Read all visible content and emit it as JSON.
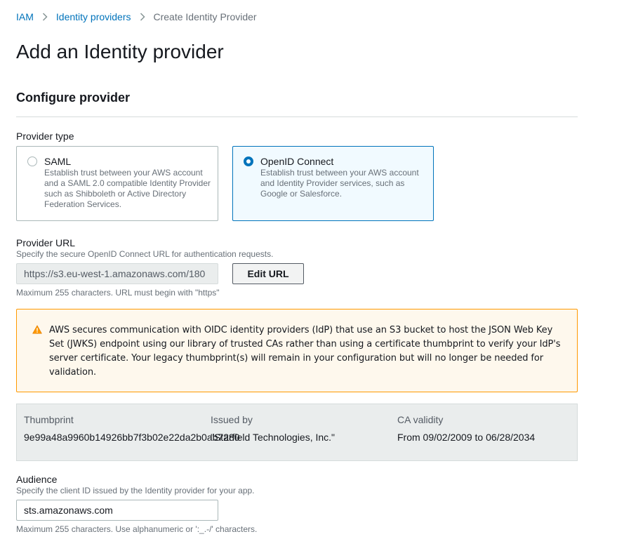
{
  "breadcrumb": {
    "items": [
      "IAM",
      "Identity providers"
    ],
    "current": "Create Identity Provider"
  },
  "page": {
    "title": "Add an Identity provider",
    "section_title": "Configure provider"
  },
  "provider_type": {
    "label": "Provider type",
    "selected": "OpenID Connect",
    "options": [
      {
        "title": "SAML",
        "description": "Establish trust between your AWS account and a SAML 2.0 compatible Identity Provider such as Shibboleth or Active Directory Federation Services."
      },
      {
        "title": "OpenID Connect",
        "description": "Establish trust between your AWS account and Identity Provider services, such as Google or Salesforce."
      }
    ]
  },
  "provider_url": {
    "label": "Provider URL",
    "description": "Specify the secure OpenID Connect URL for authentication requests.",
    "value": "https://s3.eu-west-1.amazonaws.com/180",
    "edit_button": "Edit URL",
    "hint": "Maximum 255 characters. URL must begin with \"https\""
  },
  "alert": {
    "icon": "warning-icon",
    "text": "AWS secures communication with OIDC identity providers (IdP) that use an S3 bucket to host the JSON Web Key Set (JWKS) endpoint using our library of trusted CAs rather than using a certificate thumbprint to verify your IdP's server certificate. Your legacy thumbprint(s) will remain in your configuration but will no longer be needed for validation."
  },
  "thumbprint_table": {
    "headers": [
      "Thumbprint",
      "Issued by",
      "CA validity"
    ],
    "row": [
      "9e99a48a9960b14926bb7f3b02e22da2b0ab7280",
      "\"Starfield Technologies, Inc.\"",
      "From 09/02/2009 to 06/28/2034"
    ]
  },
  "audience": {
    "label": "Audience",
    "description": "Specify the client ID issued by the Identity provider for your app.",
    "value": "sts.amazonaws.com",
    "hint": "Maximum 255 characters. Use alphanumeric or ':_.-/' characters."
  },
  "colors": {
    "link": "#0073bb",
    "selected_border": "#0073bb",
    "selected_bg": "#f1faff",
    "warning_border": "#ff9900",
    "warning_bg": "#fef8ed"
  }
}
